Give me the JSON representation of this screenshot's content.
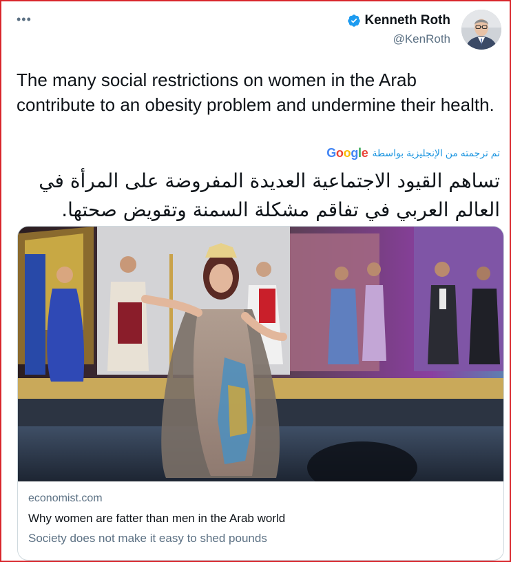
{
  "tweet": {
    "author_name": "Kenneth Roth",
    "handle": "@KenRoth",
    "text": "The many social restrictions on women in the Arab contribute to an obesity problem and undermine their health.",
    "translation_label": "تم ترجمته من الإنجليزية بواسطة",
    "translation_provider": "Google",
    "translated_text": "تساهم القيود الاجتماعية العديدة المفروضة على المرأة في العالم العربي في تفاقم مشكلة السمنة وتقويض صحتها."
  },
  "card": {
    "domain": "economist.com",
    "title": "Why women are fatter than men in the Arab world",
    "description": "Society does not make it easy to shed pounds"
  },
  "icons": {
    "more": "more-horizontal-icon",
    "verified": "verified-badge-icon"
  },
  "colors": {
    "frame_border": "#d9262c",
    "verified": "#1d9bf0",
    "link": "#1b95e0",
    "secondary_text": "#5b7083",
    "card_border": "#cfd9de"
  }
}
